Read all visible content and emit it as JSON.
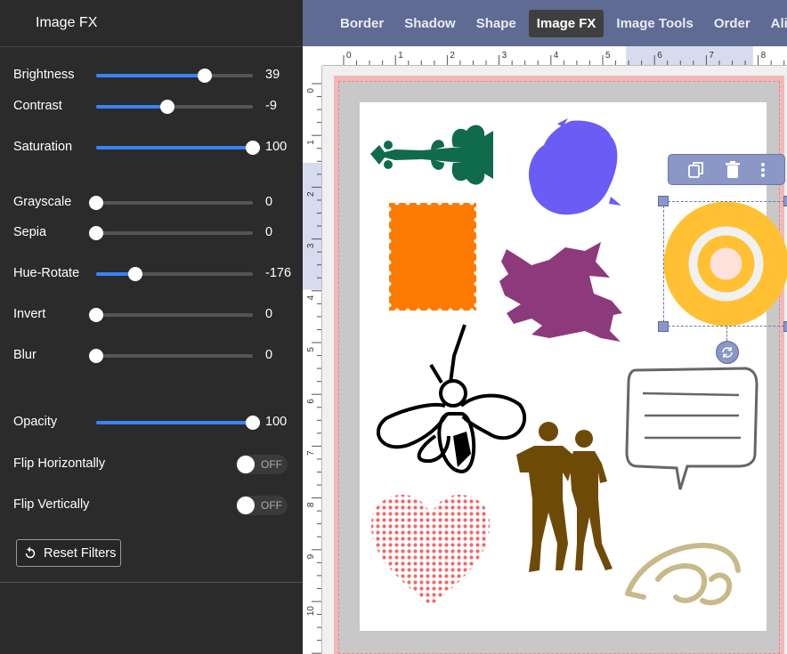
{
  "panel": {
    "title": "Image FX",
    "sliders": [
      {
        "label": "Brightness",
        "value": "39",
        "fraction": 0.695
      },
      {
        "label": "Contrast",
        "value": "-9",
        "fraction": 0.455
      },
      {
        "label": "Saturation",
        "value": "100",
        "fraction": 1.0
      },
      {
        "label": "Grayscale",
        "value": "0",
        "fraction": 0.0
      },
      {
        "label": "Sepia",
        "value": "0",
        "fraction": 0.0
      },
      {
        "label": "Hue-Rotate",
        "value": "-176",
        "fraction": 0.25
      },
      {
        "label": "Invert",
        "value": "0",
        "fraction": 0.0
      },
      {
        "label": "Blur",
        "value": "0",
        "fraction": 0.0
      },
      {
        "label": "Opacity",
        "value": "100",
        "fraction": 1.0
      }
    ],
    "toggles": [
      {
        "label": "Flip Horizontally",
        "state": "OFF"
      },
      {
        "label": "Flip Vertically",
        "state": "OFF"
      }
    ],
    "reset_label": "Reset Filters"
  },
  "tabs": [
    {
      "label": "Border",
      "active": false
    },
    {
      "label": "Shadow",
      "active": false
    },
    {
      "label": "Shape",
      "active": false
    },
    {
      "label": "Image FX",
      "active": true
    },
    {
      "label": "Image Tools",
      "active": false
    },
    {
      "label": "Order",
      "active": false
    },
    {
      "label": "Align",
      "active": false
    }
  ],
  "rulers": {
    "horizontal": [
      "0",
      "1",
      "2",
      "3",
      "4",
      "5",
      "6",
      "7",
      "8"
    ],
    "vertical": [
      "0",
      "1",
      "2",
      "3",
      "4",
      "5",
      "6",
      "7",
      "8",
      "9",
      "10"
    ]
  },
  "selection_toolbar": {
    "icons": [
      "duplicate-icon",
      "trash-icon",
      "more-vertical-icon"
    ]
  },
  "colors": {
    "accent": "#3b82f6",
    "tabbar": "#5f6b93",
    "panel_bg": "#2b2b2b",
    "selection": "#8b97c6"
  },
  "artwork": [
    {
      "name": "green-ornament-image",
      "color": "#0f6b4c"
    },
    {
      "name": "purple-swirl-image",
      "color": "#6a5cf5"
    },
    {
      "name": "orange-stamp-image",
      "color": "#ff7a00"
    },
    {
      "name": "purple-dragon-image",
      "color": "#8c3a7c"
    },
    {
      "name": "target-circle-image",
      "color": "#ffc133"
    },
    {
      "name": "bee-doodle-image",
      "color": "#000000"
    },
    {
      "name": "speech-bubble-image",
      "color": "#666666"
    },
    {
      "name": "couple-silhouette-image",
      "color": "#6e4a07"
    },
    {
      "name": "red-heart-pattern-image",
      "color": "#ef6a6a"
    },
    {
      "name": "gold-flourish-image",
      "color": "#c8b98a"
    }
  ]
}
